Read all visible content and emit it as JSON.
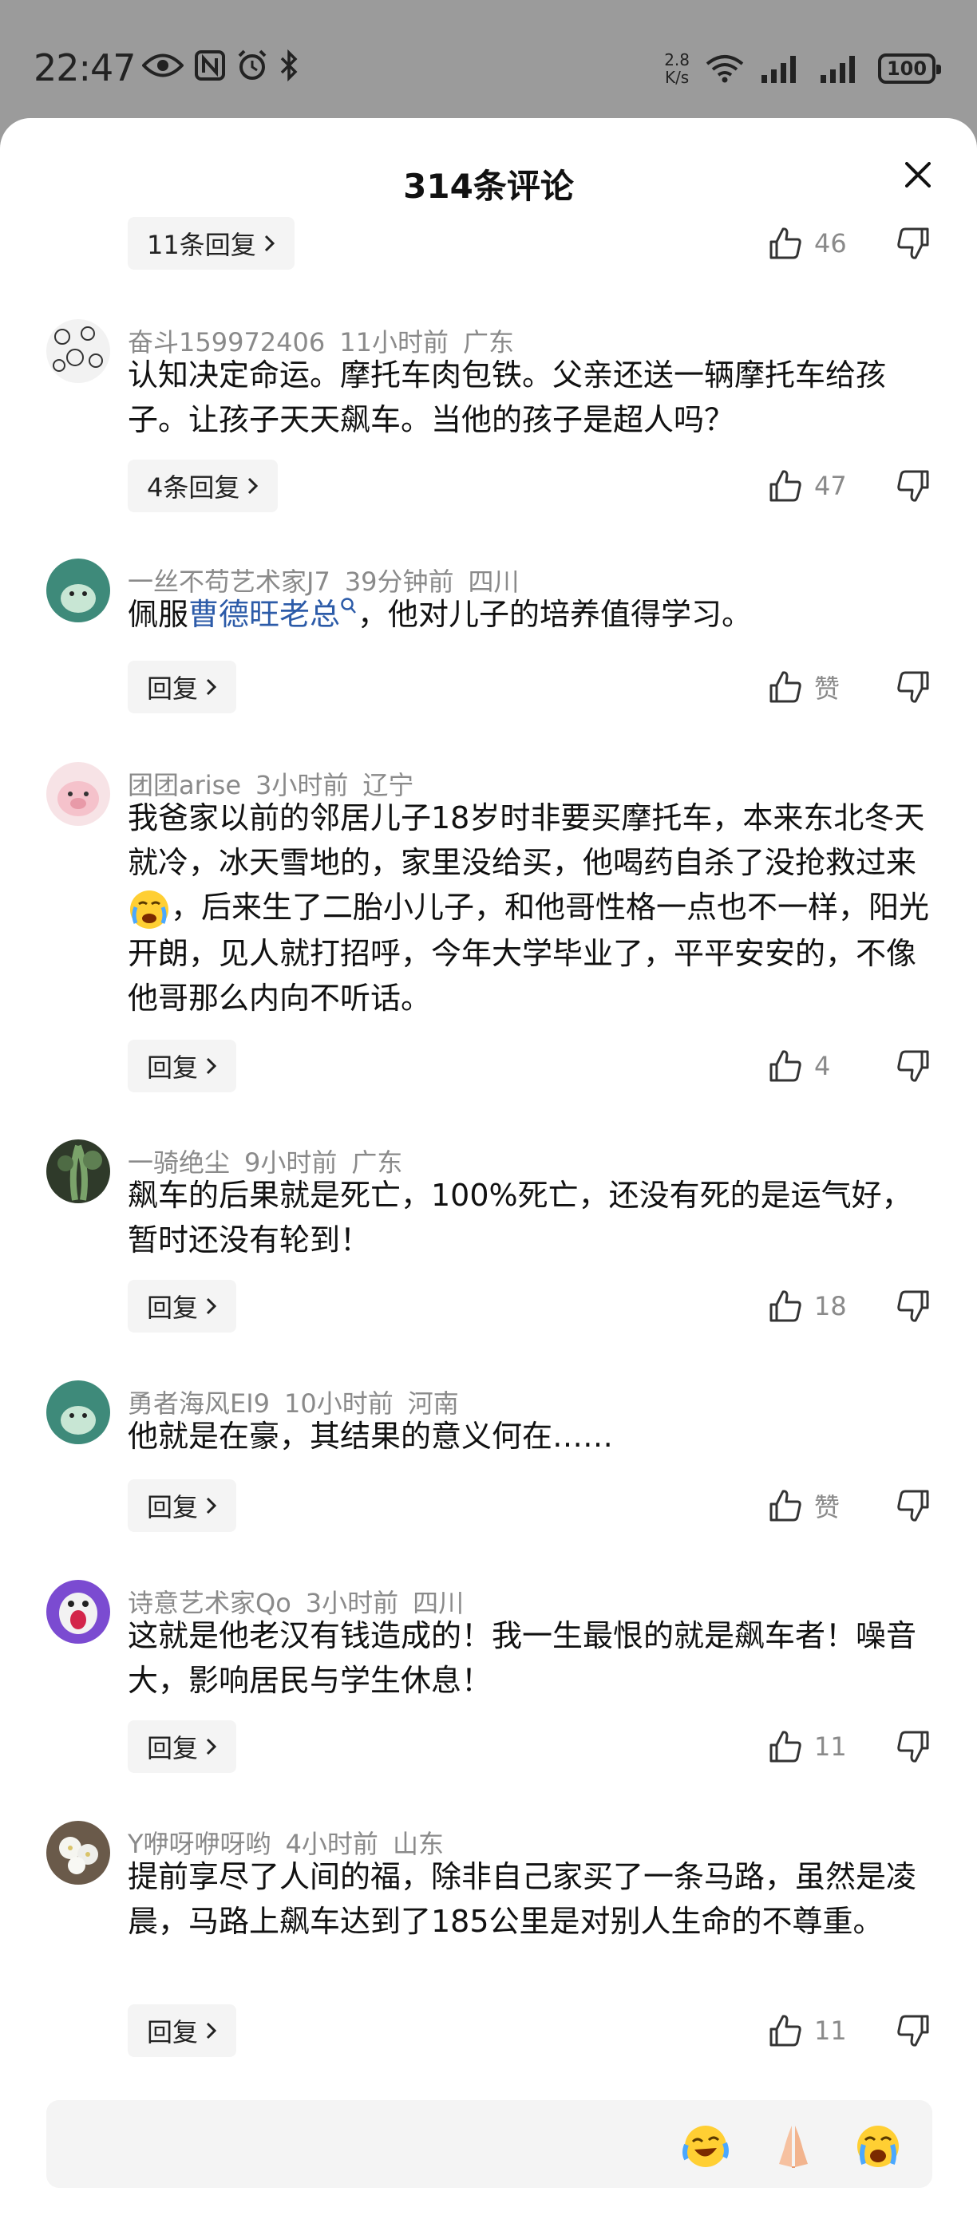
{
  "status_bar": {
    "time": "22:47",
    "net_speed_value": "2.8",
    "net_speed_unit": "K/s",
    "battery": "100",
    "icons": [
      "eye-icon",
      "nfc-icon",
      "alarm-icon",
      "bluetooth-icon",
      "wifi-icon",
      "signal-icon",
      "signal-icon"
    ]
  },
  "sheet": {
    "title": "314条评论",
    "close_icon": "close-icon"
  },
  "top_partial": {
    "reply_label": "11条回复",
    "like_count": "46"
  },
  "comments": [
    {
      "user": "奋斗159972406",
      "time": "11小时前",
      "location": "广东",
      "text": "认知决定命运。摩托车肉包铁。父亲还送一辆摩托车给孩子。让孩子天天飙车。当他的孩子是超人吗？",
      "reply_label": "4条回复",
      "likes": "47"
    },
    {
      "user": "一丝不苟艺术家J7",
      "time": "39分钟前",
      "location": "四川",
      "text_before": "佩服",
      "mention": "曹德旺老总",
      "text_after": "，他对儿子的培养值得学习。",
      "reply_label": "回复",
      "likes": "赞"
    },
    {
      "user": "团团arise",
      "time": "3小时前",
      "location": "辽宁",
      "text_before": "我爸家以前的邻居儿子18岁时非要买摩托车，本来东北冬天就冷，冰天雪地的，家里没给买，他喝药自杀了没抢救过来",
      "text_after": "，后来生了二胎小儿子，和他哥性格一点也不一样，阳光开朗，见人就打招呼，今年大学毕业了，平平安安的，不像他哥那么内向不听话。",
      "reply_label": "回复",
      "likes": "4"
    },
    {
      "user": "一骑绝尘",
      "time": "9小时前",
      "location": "广东",
      "text": "飙车的后果就是死亡，100%死亡，还没有死的是运气好，暂时还没有轮到！",
      "reply_label": "回复",
      "likes": "18"
    },
    {
      "user": "勇者海风EI9",
      "time": "10小时前",
      "location": "河南",
      "text": "他就是在豪，其结果的意义何在……",
      "reply_label": "回复",
      "likes": "赞"
    },
    {
      "user": "诗意艺术家Qo",
      "time": "3小时前",
      "location": "四川",
      "text": "这就是他老汉有钱造成的！我一生最恨的就是飙车者！噪音大，影响居民与学生休息！",
      "reply_label": "回复",
      "likes": "11"
    },
    {
      "user": "Y咿呀咿呀哟",
      "time": "4小时前",
      "location": "山东",
      "text": "提前享尽了人间的福，除非自己家买了一条马路，虽然是凌晨，马路上飙车达到了185公里是对别人生命的不尊重。",
      "reply_label": "回复",
      "likes": "11"
    }
  ],
  "input_bar": {
    "placeholder": "",
    "quick_emojis": [
      "laughing-tears-emoji",
      "praying-hands-emoji",
      "crying-emoji"
    ]
  }
}
